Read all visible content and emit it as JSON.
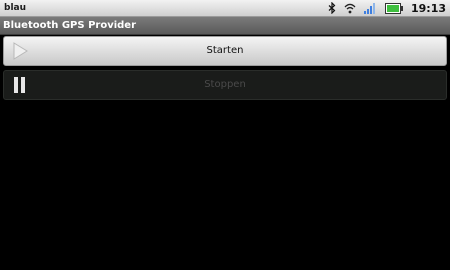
{
  "status_bar": {
    "carrier": "blau",
    "time": "19:13",
    "icons": [
      "bluetooth-icon",
      "wifi-icon",
      "signal-icon",
      "battery-icon"
    ]
  },
  "app": {
    "title": "Bluetooth GPS Provider"
  },
  "buttons": {
    "start_label": "Starten",
    "stop_label": "Stoppen",
    "start_icon": "play-icon",
    "stop_icon": "pause-icon"
  },
  "colors": {
    "background": "#000000",
    "title_bar": "#6a6a6a",
    "battery": "#3fbf3f",
    "signal": "#3f7fdf"
  }
}
